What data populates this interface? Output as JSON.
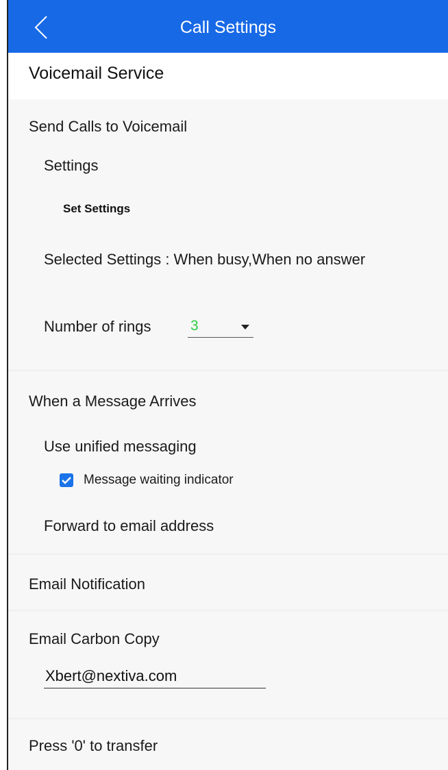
{
  "appbar": {
    "title": "Call Settings",
    "back_icon": "chevron-left-icon"
  },
  "section": {
    "title": "Voicemail Service"
  },
  "send_calls": {
    "heading": "Send Calls to Voicemail",
    "settings_label": "Settings",
    "set_settings_link": "Set Settings",
    "selected_settings": "Selected Settings : When busy,When no answer",
    "rings_label": "Number of rings",
    "rings_value": "3",
    "rings_value_color": "#2ecc40"
  },
  "message_arrives": {
    "heading": "When a Message Arrives",
    "unified_label": "Use unified messaging",
    "mwi_label": "Message waiting indicator",
    "mwi_checked": true,
    "forward_label": "Forward to email address"
  },
  "email_notification": {
    "heading": "Email Notification"
  },
  "email_cc": {
    "heading": "Email Carbon Copy",
    "value": "Xbert@nextiva.com"
  },
  "transfer": {
    "heading": "Press '0' to transfer"
  },
  "colors": {
    "appbar": "#1769e6",
    "checkbox": "#1a73e8",
    "background": "#f7f7f7"
  }
}
